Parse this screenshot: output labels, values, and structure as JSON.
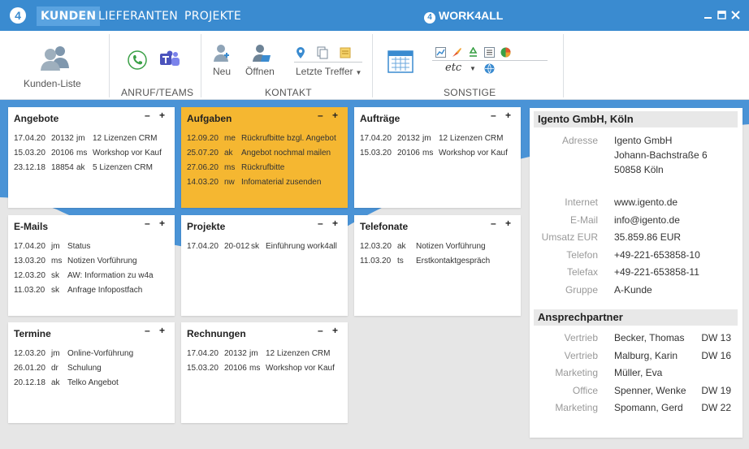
{
  "nav": {
    "logo": "4",
    "tabs": [
      "KUNDEN",
      "LIEFERANTEN",
      "PROJEKTE"
    ],
    "brand": "WORK4ALL",
    "brand_icon": "4"
  },
  "ribbon": {
    "customer_list": "Kunden-Liste",
    "call_group": "ANRUF/TEAMS",
    "contact_group": "KONTAKT",
    "neu": "Neu",
    "oeffnen": "Öffnen",
    "letzte_treffer": "Letzte Treffer",
    "misc_group": "SONSTIGE",
    "etc": "etc"
  },
  "cards": [
    {
      "title": "Angebote",
      "rows": [
        [
          "17.04.20",
          "20132",
          "jm",
          "12 Lizenzen CRM"
        ],
        [
          "15.03.20",
          "20106",
          "ms",
          "Workshop vor Kauf"
        ],
        [
          "23.12.18",
          "18854",
          "ak",
          "5 Lizenzen CRM"
        ]
      ]
    },
    {
      "title": "Aufgaben",
      "rows": [
        [
          "12.09.20",
          "me",
          "Rückrufbitte bzgl. Angebot"
        ],
        [
          "25.07.20",
          "ak",
          "Angebot nochmal mailen"
        ],
        [
          "27.06.20",
          "ms",
          "Rückrufbitte"
        ],
        [
          "14.03.20",
          "nw",
          "Infomaterial zusenden"
        ]
      ]
    },
    {
      "title": "Aufträge",
      "rows": [
        [
          "17.04.20",
          "20132",
          "jm",
          "12 Lizenzen CRM"
        ],
        [
          "15.03.20",
          "20106",
          "ms",
          "Workshop vor Kauf"
        ]
      ]
    },
    {
      "title": "E-Mails",
      "rows": [
        [
          "17.04.20",
          "jm",
          "Status"
        ],
        [
          "13.03.20",
          "ms",
          "Notizen Vorführung"
        ],
        [
          "12.03.20",
          "sk",
          "AW: Information zu w4a"
        ],
        [
          "11.03.20",
          "sk",
          "Anfrage Infopostfach"
        ]
      ]
    },
    {
      "title": "Projekte",
      "rows": [
        [
          "17.04.20",
          "20-012",
          "sk",
          "Einführung work4all"
        ]
      ]
    },
    {
      "title": "Telefonate",
      "rows": [
        [
          "12.03.20",
          "ak",
          "Notizen Vorführung"
        ],
        [
          "11.03.20",
          "ts",
          "Erstkontaktgespräch"
        ]
      ]
    },
    {
      "title": "Termine",
      "rows": [
        [
          "12.03.20",
          "jm",
          "Online-Vorführung"
        ],
        [
          "26.01.20",
          "dr",
          "Schulung"
        ],
        [
          "20.12.18",
          "ak",
          "Telko Angebot"
        ]
      ]
    },
    {
      "title": "Rechnungen",
      "rows": [
        [
          "17.04.20",
          "20132",
          "jm",
          "12 Lizenzen CRM"
        ],
        [
          "15.03.20",
          "20106",
          "ms",
          "Workshop vor Kauf"
        ]
      ]
    }
  ],
  "card_ctrl": "– +",
  "panel": {
    "title": "Igento GmbH, Köln",
    "adresse_label": "Adresse",
    "address": [
      "Igento GmbH",
      "Johann-Bachstraße 6",
      "50858 Köln"
    ],
    "fields": [
      {
        "label": "Internet",
        "value": "www.igento.de"
      },
      {
        "label": "E-Mail",
        "value": "info@igento.de"
      },
      {
        "label": "Umsatz EUR",
        "value": "35.859.86 EUR"
      },
      {
        "label": "Telefon",
        "value": "+49-221-653858-10"
      },
      {
        "label": "Telefax",
        "value": "+49-221-653858-11"
      },
      {
        "label": "Gruppe",
        "value": "A-Kunde"
      }
    ],
    "contacts_title": "Ansprechpartner",
    "contacts": [
      {
        "role": "Vertrieb",
        "name": "Becker, Thomas",
        "code": "DW 13"
      },
      {
        "role": "Vertrieb",
        "name": "Malburg, Karin",
        "code": "DW 16"
      },
      {
        "role": "Marketing",
        "name": "Müller, Eva",
        "code": ""
      },
      {
        "role": "Office",
        "name": "Spenner, Wenke",
        "code": "DW 19"
      },
      {
        "role": "Marketing",
        "name": "Spomann, Gerd",
        "code": "DW 22"
      }
    ]
  },
  "colors": {
    "accent": "#3a8bd0",
    "task_card": "#f5b731",
    "background": "#e6e6e6"
  }
}
